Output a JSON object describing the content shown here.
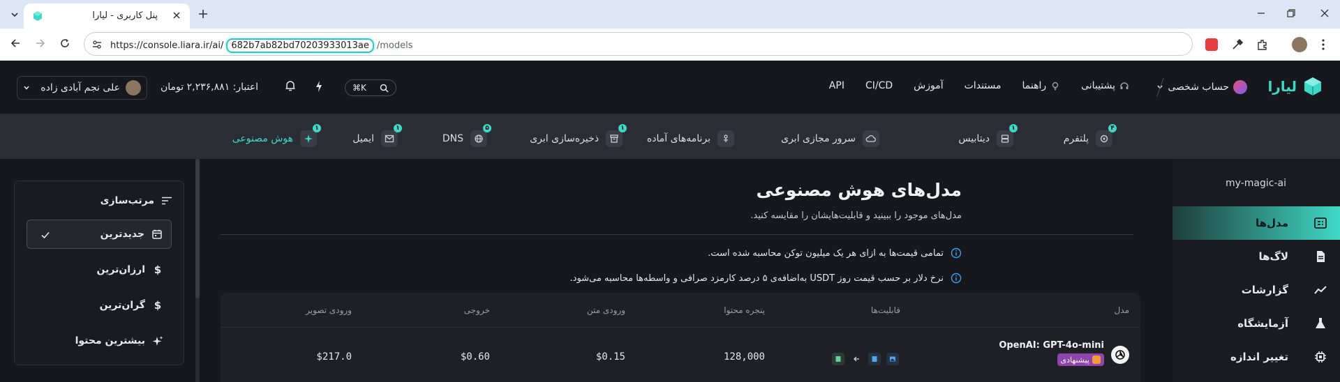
{
  "browser": {
    "tab_title": "پنل کاربری - لیارا",
    "url_prefix": "https://console.liara.ir/ai/",
    "url_highlight": "682b7ab82bd70203933013ae",
    "url_suffix": "/models"
  },
  "header": {
    "logo_text": "لیارا",
    "account_label": "حساب شخصی",
    "nav": [
      {
        "label": "پشتیبانی",
        "icon": "headset-icon"
      },
      {
        "label": "راهنما",
        "icon": "lightbulb-icon"
      },
      {
        "label": "مستندات"
      },
      {
        "label": "آموزش"
      },
      {
        "label": "CI/CD"
      },
      {
        "label": "API"
      }
    ],
    "search_shortcut": "⌘K",
    "credit": "اعتبار: ۲,۲۳۶,۸۸۱ تومان",
    "user_name": "علی نجم آبادی زاده"
  },
  "services": [
    {
      "label": "پلتفرم",
      "badge": "۴"
    },
    {
      "label": "دیتابیس",
      "badge": "۱"
    },
    {
      "label": "سرور مجازی ابری",
      "badge": ""
    },
    {
      "label": "برنامه‌های آماده",
      "badge": ""
    },
    {
      "label": "ذخیره‌سازی ابری",
      "badge": "۱"
    },
    {
      "label": "DNS",
      "badge": "۵"
    },
    {
      "label": "ایمیل",
      "badge": "۱"
    },
    {
      "label": "هوش مصنوعی",
      "badge": "۱"
    }
  ],
  "sidebar": {
    "workspace": "my-magic-ai",
    "items": [
      {
        "label": "مدل‌ها",
        "active": true
      },
      {
        "label": "لاگ‌ها"
      },
      {
        "label": "گزارشات"
      },
      {
        "label": "آزمایشگاه"
      },
      {
        "label": "تغییر اندازه"
      }
    ]
  },
  "main": {
    "title": "مدل‌های هوش مصنوعی",
    "subtitle": "مدل‌های موجود را ببینید و قابلیت‌هایشان را مقایسه کنید.",
    "notes": [
      "تمامی قیمت‌ها به ازای هر یک میلیون توکن محاسبه شده است.",
      "نرخ دلار بر حسب قیمت روز USDT به‌اضافه‌ی ۵ درصد کارمزد صرافی و واسطه‌ها محاسبه می‌شود."
    ],
    "table": {
      "headers": [
        "مدل",
        "قابلیت‌ها",
        "پنجره محتوا",
        "ورودی متن",
        "خروجی",
        "ورودی تصویر"
      ],
      "rows": [
        {
          "model": "OpenAI: GPT-4o-mini",
          "badge": "پیشنهادی",
          "context": "128,000",
          "text_input": "$0.15",
          "output": "$0.60",
          "image_input": "$217.0"
        }
      ]
    }
  },
  "sort": {
    "title": "مرتب‌سازی",
    "options": [
      {
        "label": "جدیدترین",
        "selected": true
      },
      {
        "label": "ارزان‌ترین"
      },
      {
        "label": "گران‌ترین"
      },
      {
        "label": "بیشترین محتوا"
      }
    ]
  }
}
